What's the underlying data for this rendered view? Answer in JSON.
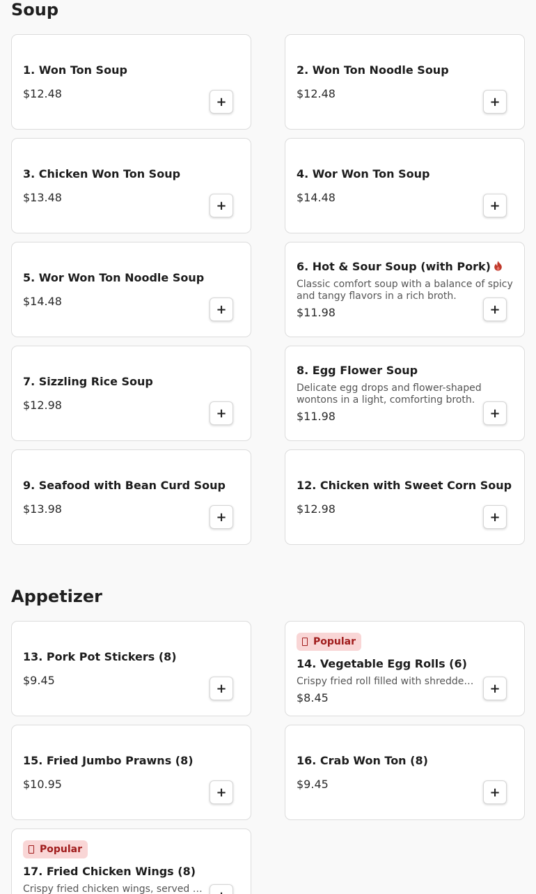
{
  "sections": {
    "soup": {
      "title": "Soup",
      "items": [
        {
          "name": "1. Won Ton Soup",
          "price": "$12.48"
        },
        {
          "name": "2. Won Ton Noodle Soup",
          "price": "$12.48"
        },
        {
          "name": "3. Chicken Won Ton Soup",
          "price": "$13.48"
        },
        {
          "name": "4. Wor Won Ton Soup",
          "price": "$14.48"
        },
        {
          "name": "5. Wor Won Ton Noodle Soup",
          "price": "$14.48"
        },
        {
          "name": "6. Hot & Sour Soup (with Pork)",
          "description": "Classic comfort soup with a balance of spicy and tangy flavors in a rich broth.",
          "price": "$11.98",
          "spicy": true,
          "spicy_icon": "flame-icon",
          "spicy_color": "#c0392b"
        },
        {
          "name": "7. Sizzling Rice Soup",
          "price": "$12.98"
        },
        {
          "name": "8. Egg Flower Soup",
          "description": "Delicate egg drops and flower-shaped wontons in a light, comforting broth.",
          "price": "$11.98"
        },
        {
          "name": "9. Seafood with Bean Curd Soup",
          "price": "$13.98"
        },
        {
          "name": "12. Chicken with Sweet Corn Soup",
          "price": "$12.98"
        }
      ]
    },
    "appetizer": {
      "title": "Appetizer",
      "items": [
        {
          "name": "13. Pork Pot Stickers (8)",
          "price": "$9.45"
        },
        {
          "name": "14. Vegetable Egg Rolls (6)",
          "description": "Crispy fried roll filled with shredded…",
          "price": "$8.45",
          "badge": "Popular"
        },
        {
          "name": "15. Fried Jumbo Prawns (8)",
          "price": "$10.95"
        },
        {
          "name": "16. Crab Won Ton (8)",
          "price": "$9.45"
        },
        {
          "name": "17. Fried Chicken Wings (8)",
          "description": "Crispy fried chicken wings, served hot",
          "price": "",
          "badge": "Popular"
        }
      ]
    }
  },
  "add_button_label": "+",
  "colors": {
    "badge_bg": "#f9d6d6",
    "badge_text": "#a01c1c",
    "card_border": "#dcdcdc",
    "page_bg": "#f9f9f9"
  }
}
